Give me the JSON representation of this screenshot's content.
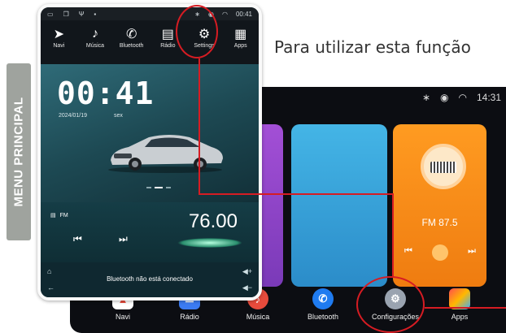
{
  "side_tag": "MENU PRINCIPAL",
  "headline": "Para utilizar esta função",
  "phone": {
    "status": {
      "time": "00:41"
    },
    "menu": [
      {
        "label": "Navi",
        "icon": "navigation-arrow-icon"
      },
      {
        "label": "Música",
        "icon": "music-note-icon"
      },
      {
        "label": "Bluetooth",
        "icon": "phone-icon"
      },
      {
        "label": "Rádio",
        "icon": "radio-icon"
      },
      {
        "label": "Settings",
        "icon": "gear-icon"
      },
      {
        "label": "Apps",
        "icon": "apps-grid-icon"
      }
    ],
    "clock": "00:41",
    "date": "2024/01/19",
    "weekday": "sex",
    "radio": {
      "band": "FM",
      "frequency": "76.00"
    },
    "bluetooth_status": "Bluetooth não está conectado"
  },
  "screen2": {
    "status": {
      "time": "14:31"
    },
    "radio_card": {
      "frequency": "FM 87.5"
    },
    "dock": [
      {
        "label": "Navi",
        "icon": "navi-app-icon",
        "color": "#ffffff"
      },
      {
        "label": "Rádio",
        "icon": "radio-app-icon",
        "color": "#3b7bf2"
      },
      {
        "label": "Música",
        "icon": "music-app-icon",
        "color": "#e74b3c"
      },
      {
        "label": "Bluetooth",
        "icon": "bluetooth-phone-app-icon",
        "color": "#1f7bf0"
      },
      {
        "label": "Configurações",
        "icon": "settings-gear-app-icon",
        "color": "#9aa3b0"
      },
      {
        "label": "Apps",
        "icon": "apps-app-icon",
        "color": "#ffb800"
      }
    ]
  },
  "colors": {
    "accent_red": "#d61c23",
    "tag_gray": "#9fa39e"
  }
}
